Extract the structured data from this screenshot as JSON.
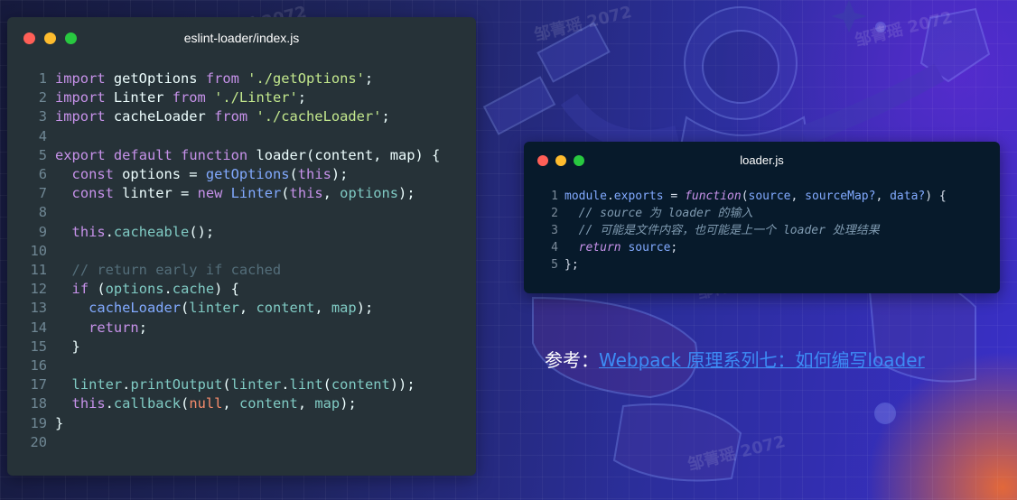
{
  "left_window": {
    "title": "eslint-loader/index.js",
    "lines": [
      {
        "n": "1",
        "tokens": [
          [
            "k",
            "import"
          ],
          [
            "t",
            " getOptions "
          ],
          [
            "k",
            "from"
          ],
          [
            "t",
            " "
          ],
          [
            "s",
            "'./getOptions'"
          ],
          [
            "t",
            ";"
          ]
        ]
      },
      {
        "n": "2",
        "tokens": [
          [
            "k",
            "import"
          ],
          [
            "t",
            " Linter "
          ],
          [
            "k",
            "from"
          ],
          [
            "t",
            " "
          ],
          [
            "s",
            "'./Linter'"
          ],
          [
            "t",
            ";"
          ]
        ]
      },
      {
        "n": "3",
        "tokens": [
          [
            "k",
            "import"
          ],
          [
            "t",
            " cacheLoader "
          ],
          [
            "k",
            "from"
          ],
          [
            "t",
            " "
          ],
          [
            "s",
            "'./cacheLoader'"
          ],
          [
            "t",
            ";"
          ]
        ]
      },
      {
        "n": "4",
        "tokens": []
      },
      {
        "n": "5",
        "tokens": [
          [
            "k",
            "export"
          ],
          [
            "t",
            " "
          ],
          [
            "k",
            "default"
          ],
          [
            "t",
            " "
          ],
          [
            "k",
            "function"
          ],
          [
            "t",
            " loader(content, map) {"
          ]
        ]
      },
      {
        "n": "6",
        "tokens": [
          [
            "t",
            "  "
          ],
          [
            "k",
            "const"
          ],
          [
            "t",
            " options = "
          ],
          [
            "f",
            "getOptions"
          ],
          [
            "t",
            "("
          ],
          [
            "k",
            "this"
          ],
          [
            "t",
            ");"
          ]
        ]
      },
      {
        "n": "7",
        "tokens": [
          [
            "t",
            "  "
          ],
          [
            "k",
            "const"
          ],
          [
            "t",
            " linter = "
          ],
          [
            "k",
            "new"
          ],
          [
            "t",
            " "
          ],
          [
            "f",
            "Linter"
          ],
          [
            "t",
            "("
          ],
          [
            "k",
            "this"
          ],
          [
            "t",
            ", "
          ],
          [
            "v",
            "options"
          ],
          [
            "t",
            ");"
          ]
        ]
      },
      {
        "n": "8",
        "tokens": []
      },
      {
        "n": "9",
        "tokens": [
          [
            "t",
            "  "
          ],
          [
            "k",
            "this"
          ],
          [
            "t",
            "."
          ],
          [
            "v",
            "cacheable"
          ],
          [
            "t",
            "();"
          ]
        ]
      },
      {
        "n": "10",
        "tokens": []
      },
      {
        "n": "11",
        "tokens": [
          [
            "t",
            "  "
          ],
          [
            "c",
            "// return early if cached"
          ]
        ]
      },
      {
        "n": "12",
        "tokens": [
          [
            "t",
            "  "
          ],
          [
            "k",
            "if"
          ],
          [
            "t",
            " ("
          ],
          [
            "v",
            "options"
          ],
          [
            "t",
            "."
          ],
          [
            "v",
            "cache"
          ],
          [
            "t",
            ") {"
          ]
        ]
      },
      {
        "n": "13",
        "tokens": [
          [
            "t",
            "    "
          ],
          [
            "f",
            "cacheLoader"
          ],
          [
            "t",
            "("
          ],
          [
            "v",
            "linter"
          ],
          [
            "t",
            ", "
          ],
          [
            "v",
            "content"
          ],
          [
            "t",
            ", "
          ],
          [
            "v",
            "map"
          ],
          [
            "t",
            ");"
          ]
        ]
      },
      {
        "n": "14",
        "tokens": [
          [
            "t",
            "    "
          ],
          [
            "k",
            "return"
          ],
          [
            "t",
            ";"
          ]
        ]
      },
      {
        "n": "15",
        "tokens": [
          [
            "t",
            "  }"
          ]
        ]
      },
      {
        "n": "16",
        "tokens": []
      },
      {
        "n": "17",
        "tokens": [
          [
            "t",
            "  "
          ],
          [
            "v",
            "linter"
          ],
          [
            "t",
            "."
          ],
          [
            "v",
            "printOutput"
          ],
          [
            "t",
            "("
          ],
          [
            "v",
            "linter"
          ],
          [
            "t",
            "."
          ],
          [
            "v",
            "lint"
          ],
          [
            "t",
            "("
          ],
          [
            "v",
            "content"
          ],
          [
            "t",
            "));"
          ]
        ]
      },
      {
        "n": "18",
        "tokens": [
          [
            "t",
            "  "
          ],
          [
            "k",
            "this"
          ],
          [
            "t",
            "."
          ],
          [
            "v",
            "callback"
          ],
          [
            "t",
            "("
          ],
          [
            "n",
            "null"
          ],
          [
            "t",
            ", "
          ],
          [
            "v",
            "content"
          ],
          [
            "t",
            ", "
          ],
          [
            "v",
            "map"
          ],
          [
            "t",
            ");"
          ]
        ]
      },
      {
        "n": "19",
        "tokens": [
          [
            "t",
            "}"
          ]
        ]
      },
      {
        "n": "20",
        "tokens": []
      }
    ]
  },
  "right_window": {
    "title": "loader.js",
    "lines": [
      {
        "n": "1",
        "tokens": [
          [
            "prop",
            "module"
          ],
          [
            "t",
            "."
          ],
          [
            "prop",
            "exports"
          ],
          [
            "t",
            " = "
          ],
          [
            "ki",
            "function"
          ],
          [
            "t",
            "("
          ],
          [
            "prop",
            "source"
          ],
          [
            "t",
            ", "
          ],
          [
            "prop",
            "sourceMap?"
          ],
          [
            "t",
            ", "
          ],
          [
            "prop",
            "data?"
          ],
          [
            "t",
            ") {"
          ]
        ]
      },
      {
        "n": "2",
        "tokens": [
          [
            "t",
            "  "
          ],
          [
            "ci",
            "// source 为 loader 的输入"
          ]
        ]
      },
      {
        "n": "3",
        "tokens": [
          [
            "t",
            "  "
          ],
          [
            "ci",
            "// 可能是文件内容，也可能是上一个 loader 处理结果"
          ]
        ]
      },
      {
        "n": "4",
        "tokens": [
          [
            "t",
            "  "
          ],
          [
            "ki",
            "return"
          ],
          [
            "t",
            " "
          ],
          [
            "prop",
            "source"
          ],
          [
            "t",
            ";"
          ]
        ]
      },
      {
        "n": "5",
        "tokens": [
          [
            "t",
            "};"
          ]
        ]
      }
    ]
  },
  "caption": {
    "prefix": "参考：",
    "link_text": "Webpack 原理系列七：如何编写loader"
  },
  "watermark_text": "邹菁瑶 2072",
  "colors": {
    "left_bg": "#263238",
    "right_bg": "#071a2b",
    "link": "#3d8cf5",
    "keyword": "#c792ea",
    "string": "#c3e88d",
    "function": "#82aaff",
    "variable": "#80cbc4",
    "comment": "#546e7a",
    "number": "#f78c6c"
  }
}
